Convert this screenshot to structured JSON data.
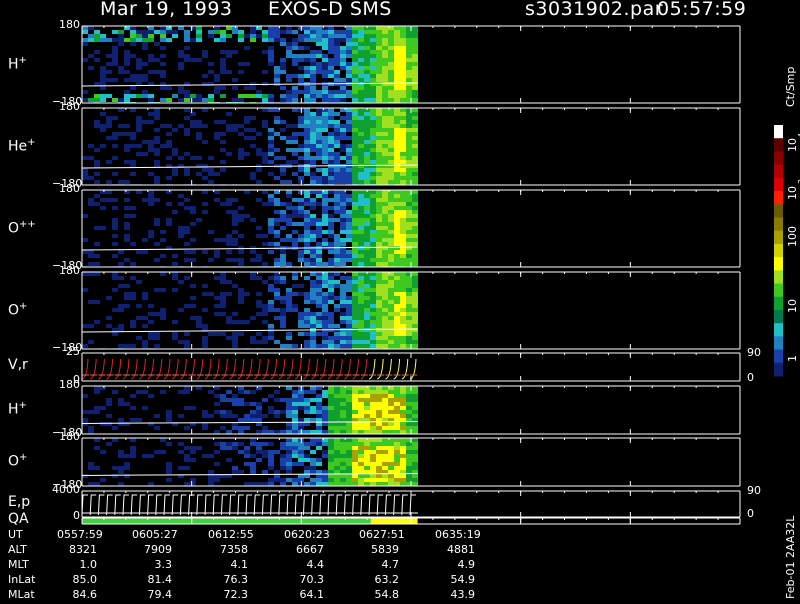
{
  "header": {
    "date": "Mar 19, 1993",
    "mission": "EXOS-D SMS",
    "file": "s3031902.par",
    "time": "05:57:59"
  },
  "panels": [
    {
      "label": "H",
      "sup": "+",
      "top_tick": "180",
      "bottom_tick": "−180"
    },
    {
      "label": "He",
      "sup": "+",
      "top_tick": "180",
      "bottom_tick": "−180"
    },
    {
      "label": "O",
      "sup": "++",
      "top_tick": "180",
      "bottom_tick": "−180"
    },
    {
      "label": "O",
      "sup": "+",
      "top_tick": "180",
      "bottom_tick": "−180"
    },
    {
      "label": "V,r",
      "sup": "",
      "top_tick": "25",
      "bottom_tick": "0",
      "right_top": "90",
      "right_bottom": "0"
    },
    {
      "label": "H",
      "sup": "+",
      "top_tick": "180",
      "bottom_tick": "−180"
    },
    {
      "label": "O",
      "sup": "+",
      "top_tick": "180",
      "bottom_tick": "−180"
    },
    {
      "label": "E,p",
      "sup": "",
      "top_tick": "4000",
      "bottom_tick": "0",
      "right_top": "90",
      "right_bottom": "0"
    },
    {
      "label": "QA",
      "sup": "",
      "top_tick": "",
      "bottom_tick": ""
    }
  ],
  "colorbar": {
    "unit": "Ct/Smp",
    "labels": [
      "10",
      "4",
      "10",
      "3",
      "100",
      "10",
      "1"
    ],
    "colors": [
      "#ffffff",
      "#5a0000",
      "#8a0000",
      "#b00000",
      "#dc0000",
      "#ff2000",
      "#6a5a00",
      "#8a7a00",
      "#aaa000",
      "#d2d200",
      "#ffff00",
      "#a0e020",
      "#3ec820",
      "#10a030",
      "#007850",
      "#20c0c8",
      "#2080c0",
      "#1840a8",
      "#102070"
    ]
  },
  "table": {
    "rows": [
      {
        "name": "UT",
        "values": [
          "0557:59",
          "0605:27",
          "0612:55",
          "0620:23",
          "0627:51",
          "0635:19"
        ]
      },
      {
        "name": "ALT",
        "values": [
          "8321",
          "7909",
          "7358",
          "6667",
          "5839",
          "4881"
        ]
      },
      {
        "name": "MLT",
        "values": [
          "1.0",
          "3.3",
          "4.1",
          "4.4",
          "4.7",
          "4.9"
        ]
      },
      {
        "name": "InLat",
        "values": [
          "85.0",
          "81.4",
          "76.3",
          "70.3",
          "63.2",
          "54.9"
        ]
      },
      {
        "name": "MLat",
        "values": [
          "84.6",
          "79.4",
          "72.3",
          "64.1",
          "54.8",
          "43.9"
        ]
      }
    ]
  },
  "footer": {
    "id": "Feb-01 2AA32L"
  },
  "chart_data": {
    "type": "heatmap",
    "x": [
      "0557:59",
      "0605:27",
      "0612:55",
      "0620:23",
      "0627:51",
      "0635:19"
    ],
    "data_end_fraction": 0.51,
    "colorscale_min": 1,
    "colorscale_max": 10000,
    "colorscale_unit": "Ct/Smp",
    "log_scale": true
  }
}
